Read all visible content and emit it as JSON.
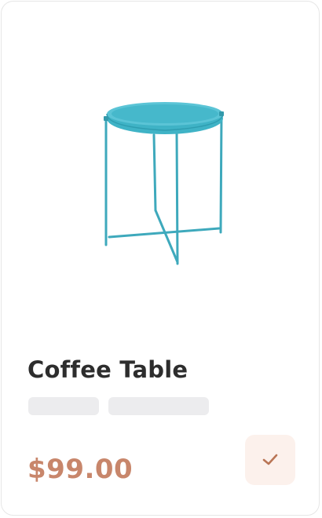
{
  "product": {
    "title": "Coffee Table",
    "price": "$99.00",
    "image_icon": "tray-side-table",
    "image_color": "#4fb6c8"
  },
  "action": {
    "icon": "check-icon",
    "accent_color": "#c8866b"
  }
}
